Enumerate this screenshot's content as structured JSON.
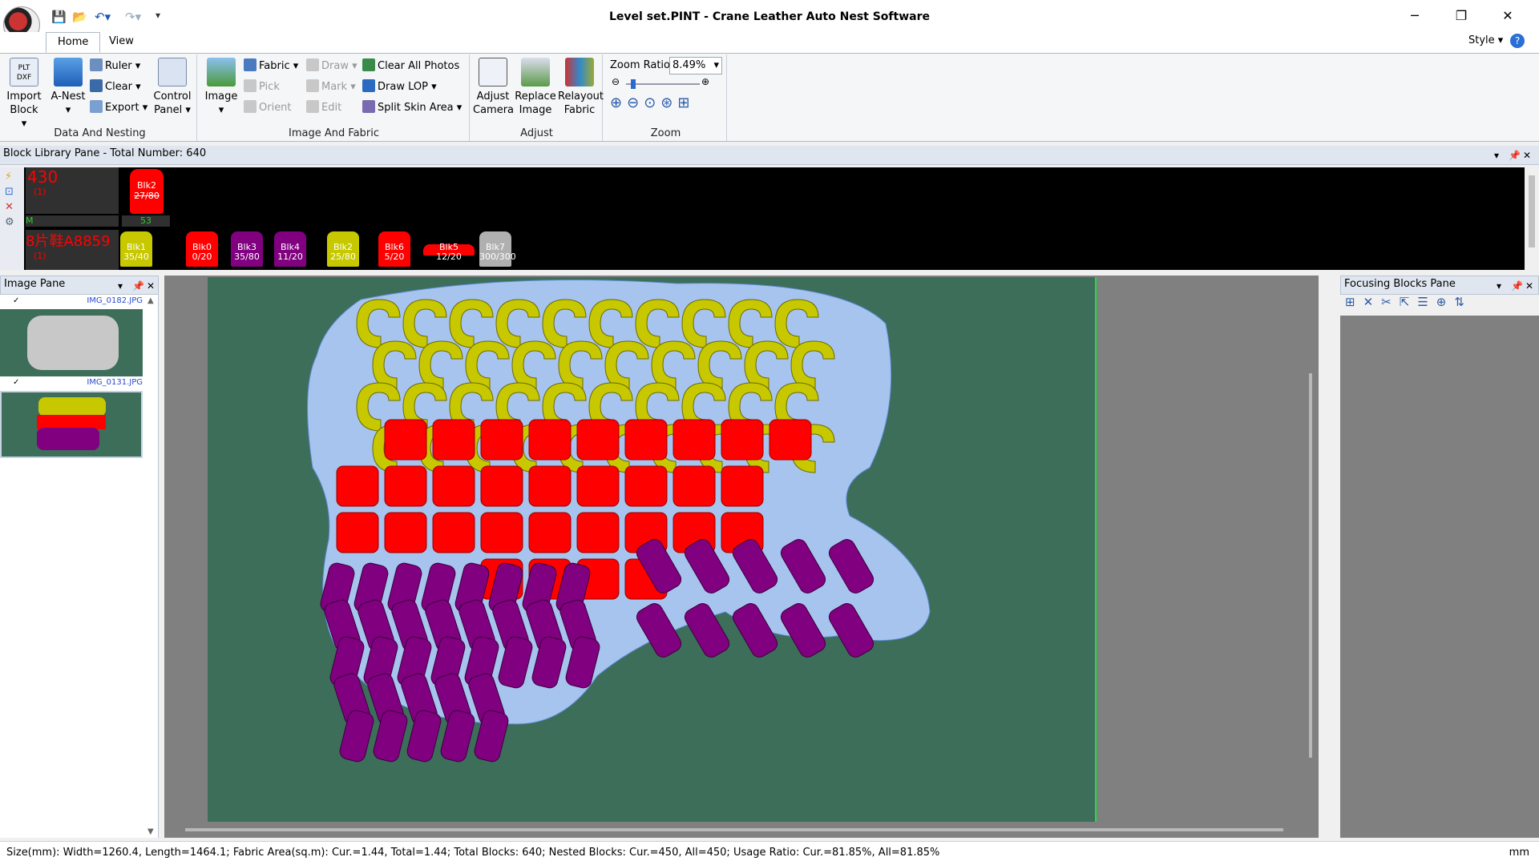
{
  "window": {
    "title": "Level set.PINT - Crane Leather Auto Nest Software",
    "minimize": "─",
    "restore": "❐",
    "close": "✕"
  },
  "quick_access": [
    "save-icon",
    "open-icon",
    "undo-icon",
    "redo-icon",
    "customize-icon"
  ],
  "tabs": [
    {
      "label": "Home"
    },
    {
      "label": "View"
    }
  ],
  "style_menu": {
    "label": "Style"
  },
  "ribbon": {
    "data_nesting": {
      "label": "Data And Nesting",
      "import_block": "Import Block",
      "a_nest": "A-Nest",
      "ruler": "Ruler",
      "clear": "Clear",
      "export": "Export",
      "control_panel": "Control Panel"
    },
    "image_fabric": {
      "label": "Image And Fabric",
      "image": "Image",
      "fabric": "Fabric",
      "pick": "Pick",
      "orient": "Orient",
      "draw": "Draw",
      "mark": "Mark",
      "edit": "Edit",
      "clear_all_photos": "Clear All Photos",
      "draw_lop": "Draw LOP",
      "split_skin_area": "Split Skin Area"
    },
    "adjust": {
      "label": "Adjust",
      "adjust_camera": "Adjust Camera",
      "replace_image": "Replace Image",
      "relayout_fabric": "Relayout Fabric"
    },
    "zoom": {
      "label": "Zoom",
      "ratio_label": "Zoom Ratio",
      "ratio_value": "8.49%"
    }
  },
  "block_library": {
    "title": "Block Library Pane - Total Number: 640",
    "row1": {
      "count": "430",
      "sub": "(1)",
      "size": "M",
      "total": "53"
    },
    "row2": {
      "name": "8片鞋A8859",
      "sub": "(1)"
    },
    "top_block": {
      "name": "Blk2",
      "count": "27/80"
    },
    "blocks": [
      {
        "name": "Blk1",
        "count": "35/40",
        "color": "#c8c800"
      },
      {
        "name": "Blk0",
        "count": "0/20",
        "color": "#ff0000"
      },
      {
        "name": "Blk3",
        "count": "35/80",
        "color": "#800080"
      },
      {
        "name": "Blk4",
        "count": "11/20",
        "color": "#800080"
      },
      {
        "name": "Blk2",
        "count": "25/80",
        "color": "#c8c800"
      },
      {
        "name": "Blk6",
        "count": "5/20",
        "color": "#ff0000"
      },
      {
        "name": "Blk5",
        "count": "12/20",
        "color": "#ff0000"
      },
      {
        "name": "Blk7",
        "count": "300/300",
        "color": "#b0b0b0"
      }
    ]
  },
  "image_pane": {
    "title": "Image Pane",
    "images": [
      {
        "name": "IMG_0182.JPG"
      },
      {
        "name": "IMG_0131.JPG"
      }
    ]
  },
  "focus_pane": {
    "title": "Focusing Blocks Pane"
  },
  "status": {
    "text": "Size(mm): Width=1260.4, Length=1464.1; Fabric Area(sq.m): Cur.=1.44, Total=1.44; Total Blocks: 640; Nested Blocks: Cur.=450, All=450; Usage Ratio: Cur.=81.85%, All=81.85%",
    "unit": "mm"
  },
  "colors": {
    "yellow": "#c8c800",
    "red": "#ff0000",
    "purple": "#800080",
    "navy": "#0a1a6e",
    "board": "#3c6e5a"
  }
}
